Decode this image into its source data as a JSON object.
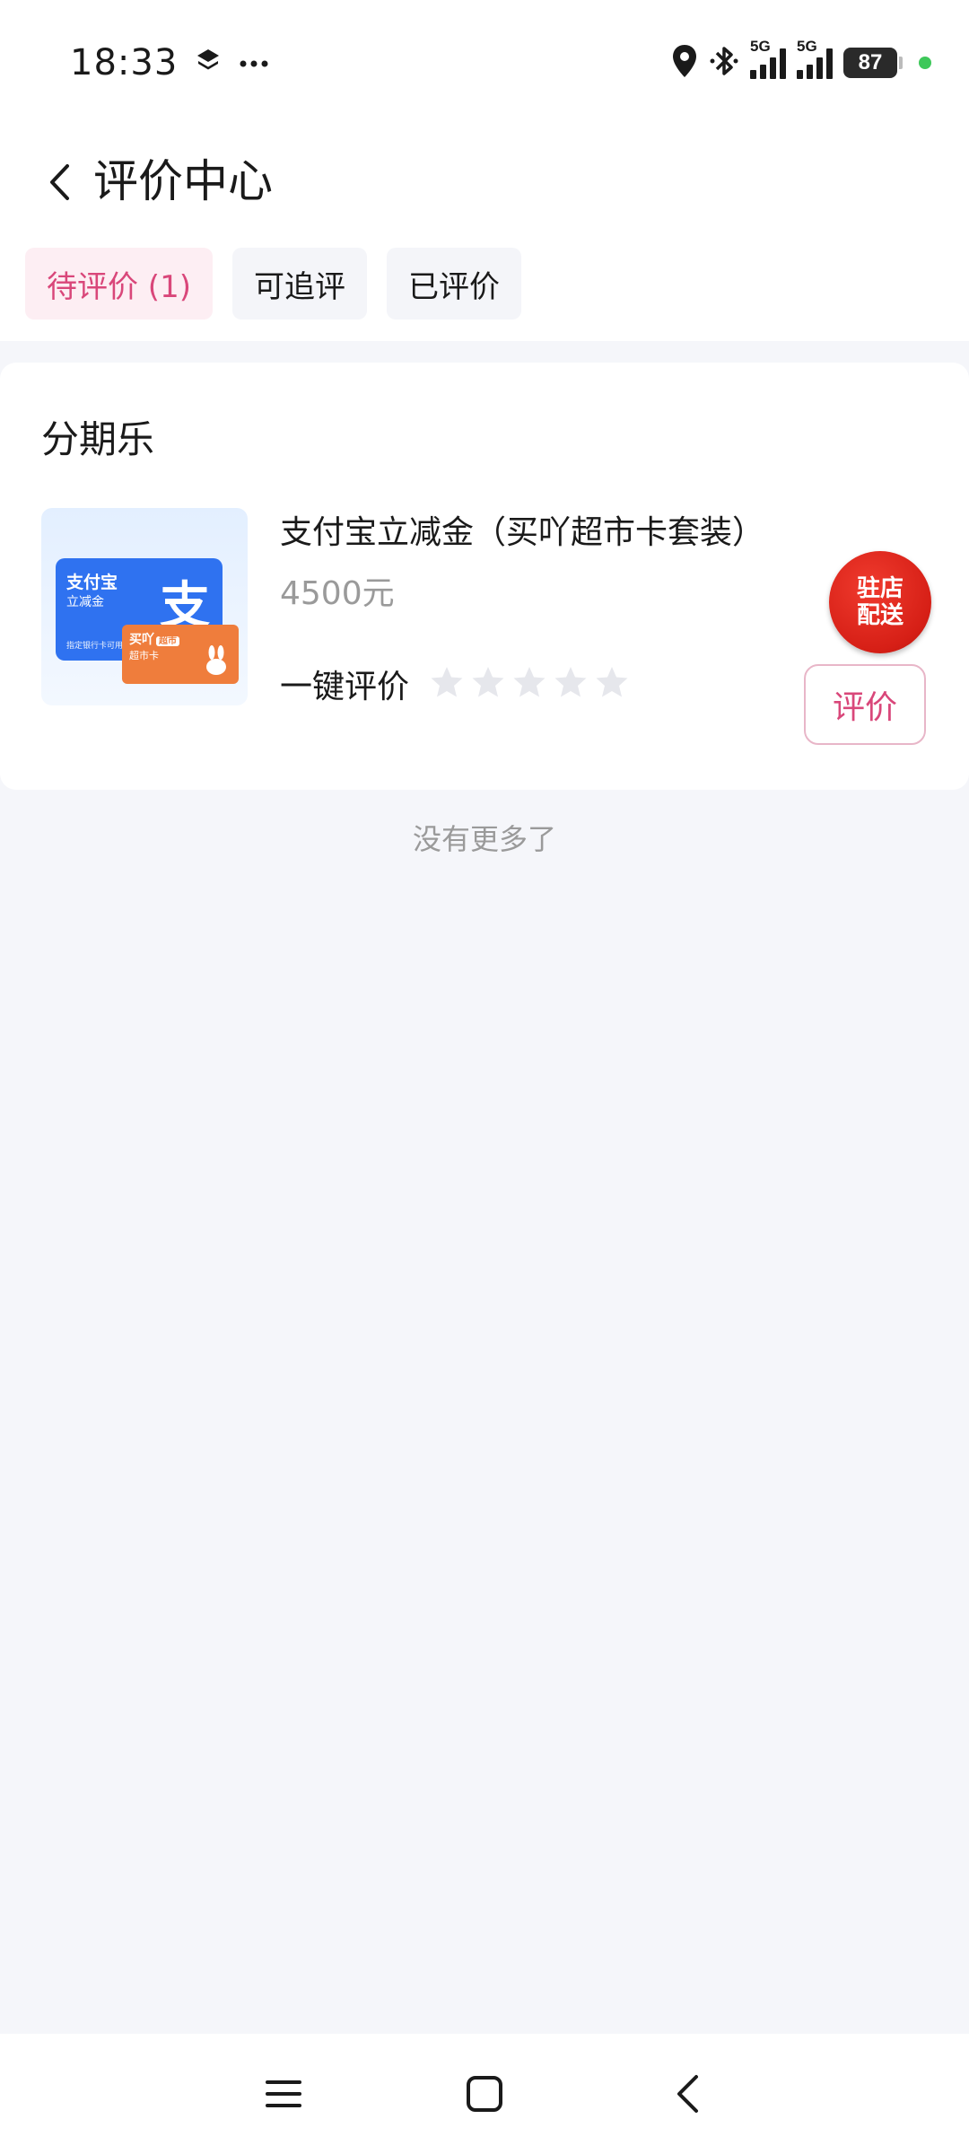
{
  "status_bar": {
    "time": "18:33",
    "battery": "87",
    "network_label": "5G",
    "icons": [
      "layers-icon",
      "more-dots-icon",
      "location-icon",
      "bluetooth-icon",
      "signal-icon",
      "battery-icon"
    ]
  },
  "header": {
    "title": "评价中心",
    "back_icon": "chevron-left-icon"
  },
  "tabs": [
    {
      "label": "待评价 (1)",
      "active": true
    },
    {
      "label": "可追评",
      "active": false
    },
    {
      "label": "已评价",
      "active": false
    }
  ],
  "order": {
    "shop_name": "分期乐",
    "product_name": "支付宝立减金（买吖超市卡套装）",
    "price": "4500元",
    "quick_review_label": "一键评价",
    "star_count": 5,
    "badge_line1": "驻店",
    "badge_line2": "配送",
    "review_button": "评价",
    "thumbnail": {
      "card_title": "支付宝",
      "card_subtitle": "立减金",
      "card_fine_print": "指定银行卡可用",
      "card_logo": "支",
      "mini_card_brand": "买吖",
      "mini_card_tag": "超市",
      "mini_card_text": "超市卡"
    }
  },
  "footer_text": "没有更多了",
  "nav": [
    "menu-icon",
    "home-icon",
    "back-icon"
  ],
  "colors": {
    "accent": "#d9477a",
    "tab_active_bg": "#fdeef3",
    "page_bg": "#f5f6fa",
    "badge_red": "#d61f16"
  }
}
